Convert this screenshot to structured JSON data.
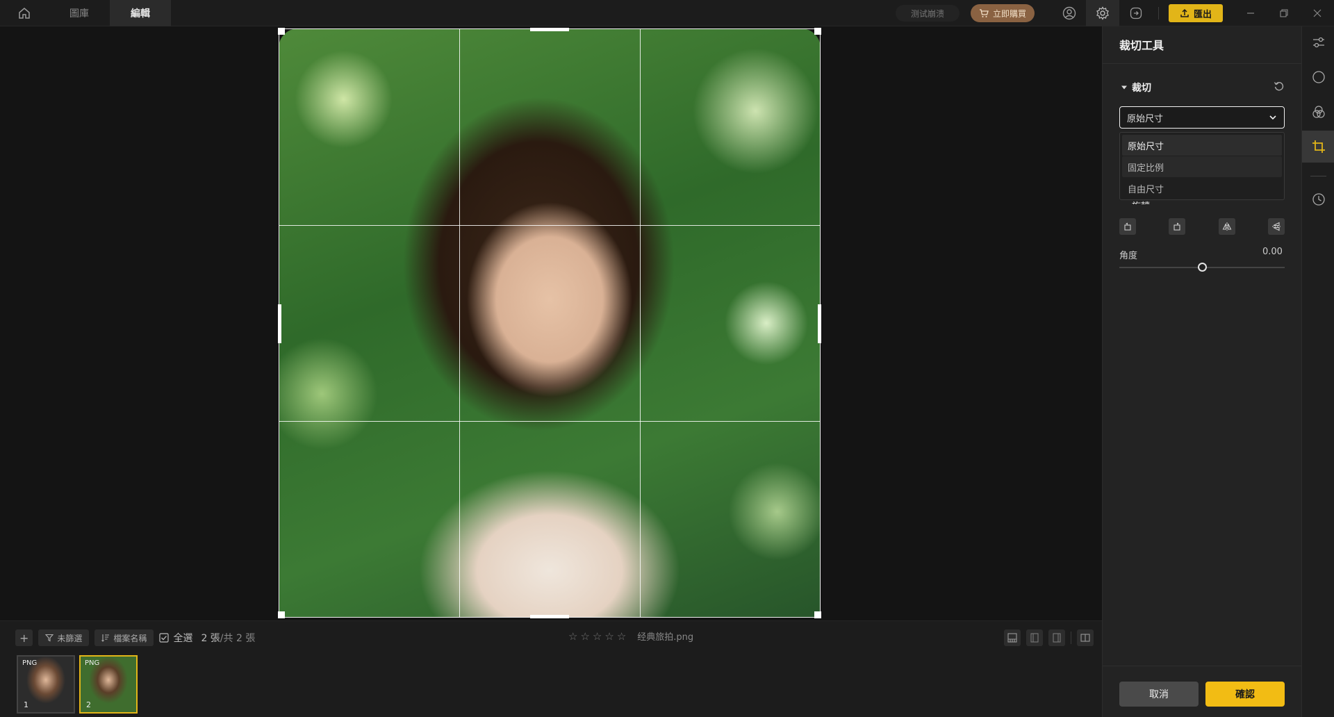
{
  "topbar": {
    "tabs": [
      {
        "label": "圖庫",
        "active": false
      },
      {
        "label": "編輯",
        "active": true
      }
    ],
    "trial_label": "测试崩溃",
    "buy_label": "立即購買",
    "export_label": "匯出",
    "icons": [
      "home-icon",
      "user-icon",
      "gear-icon",
      "share-icon",
      "minimize-icon",
      "restore-icon",
      "close-icon"
    ],
    "accent": "#e2b518"
  },
  "canvas": {
    "image_description_note": ""
  },
  "bottom": {
    "add_label": "+",
    "filter_label": "未篩選",
    "sort_label": "檔案名稱",
    "select_all_label": "全選",
    "count_selected": "2 張",
    "count_total": "/共 2 張",
    "rating_stars": 0,
    "max_stars": 5,
    "filename": "经典旅拍.png",
    "thumbnails": [
      {
        "badge": "PNG",
        "num": "1",
        "selected": false
      },
      {
        "badge": "PNG",
        "num": "2",
        "selected": true
      }
    ]
  },
  "panel": {
    "title": "裁切工具",
    "section": "裁切",
    "select_value": "原始尺寸",
    "options": [
      "原始尺寸",
      "固定比例",
      "自由尺寸"
    ],
    "rotate_label": "旋轉",
    "angle_label": "角度",
    "angle_value": "0.00",
    "angle_fraction": 0.5,
    "cancel_label": "取消",
    "confirm_label": "確認",
    "confirm_color": "#f2bc14"
  },
  "rail": {
    "icons": [
      "sliders-icon",
      "circle-icon",
      "color-circles-icon",
      "crop-icon",
      "history-icon"
    ],
    "active": "crop-icon"
  }
}
